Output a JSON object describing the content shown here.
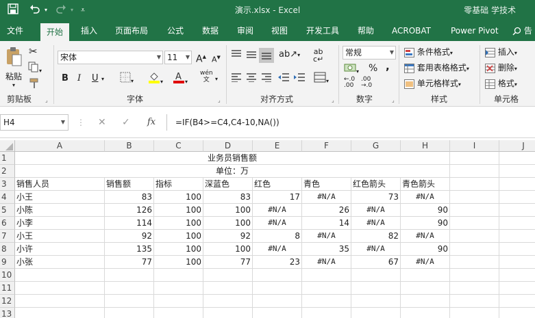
{
  "titlebar": {
    "doc_title": "演示.xlsx  -  Excel",
    "user": "零基础 学技术",
    "save_icon": "save-icon",
    "undo_icon": "undo-icon",
    "redo_icon": "redo-icon",
    "customize_icon": "customize-quick-access-icon"
  },
  "menu": {
    "items": [
      "文件",
      "开始",
      "插入",
      "页面布局",
      "公式",
      "数据",
      "审阅",
      "视图",
      "开发工具",
      "帮助",
      "ACROBAT",
      "Power Pivot",
      "告"
    ],
    "active": "开始"
  },
  "ribbon": {
    "clipboard": {
      "label": "剪贴板",
      "paste": "粘贴"
    },
    "font": {
      "label": "字体",
      "name": "宋体",
      "size": "11",
      "bold": "B",
      "italic": "I",
      "underline": "U",
      "grow": "A",
      "shrink": "A",
      "phonetic": "wén"
    },
    "alignment": {
      "label": "对齐方式"
    },
    "number": {
      "label": "数字",
      "format": "常规",
      "percent": "%",
      "comma": ","
    },
    "styles": {
      "label": "样式",
      "conditional": "条件格式",
      "table": "套用表格格式",
      "cell_styles": "单元格样式"
    },
    "cells": {
      "label": "单元格",
      "insert": "插入",
      "delete": "删除",
      "format": "格式"
    }
  },
  "formula_bar": {
    "name_box": "H4",
    "cancel": "✕",
    "enter": "✓",
    "fx": "fx",
    "formula": "=IF(B4>=C4,C4-10,NA())"
  },
  "sheet": {
    "columns": [
      "A",
      "B",
      "C",
      "D",
      "E",
      "F",
      "G",
      "H",
      "I",
      "J"
    ],
    "rows": [
      "1",
      "2",
      "3",
      "4",
      "5",
      "6",
      "7",
      "8",
      "9",
      "10",
      "11",
      "12",
      "13"
    ],
    "title": "业务员销售额",
    "unit": "单位：万",
    "headers": [
      "销售人员",
      "销售额",
      "指标",
      "深蓝色",
      "红色",
      "青色",
      "红色箭头",
      "青色箭头"
    ],
    "data": [
      [
        "小王",
        "83",
        "100",
        "83",
        "17",
        "#N/A",
        "73",
        "#N/A"
      ],
      [
        "小陈",
        "126",
        "100",
        "100",
        "#N/A",
        "26",
        "#N/A",
        "90"
      ],
      [
        "小李",
        "114",
        "100",
        "100",
        "#N/A",
        "14",
        "#N/A",
        "90"
      ],
      [
        "小王",
        "92",
        "100",
        "92",
        "8",
        "#N/A",
        "82",
        "#N/A"
      ],
      [
        "小许",
        "135",
        "100",
        "100",
        "#N/A",
        "35",
        "#N/A",
        "90"
      ],
      [
        "小张",
        "77",
        "100",
        "77",
        "23",
        "#N/A",
        "67",
        "#N/A"
      ]
    ]
  },
  "colors": {
    "accent": "#217346",
    "ribbon_bg": "#f3f3f3",
    "header_bg": "#f0f0f0"
  }
}
